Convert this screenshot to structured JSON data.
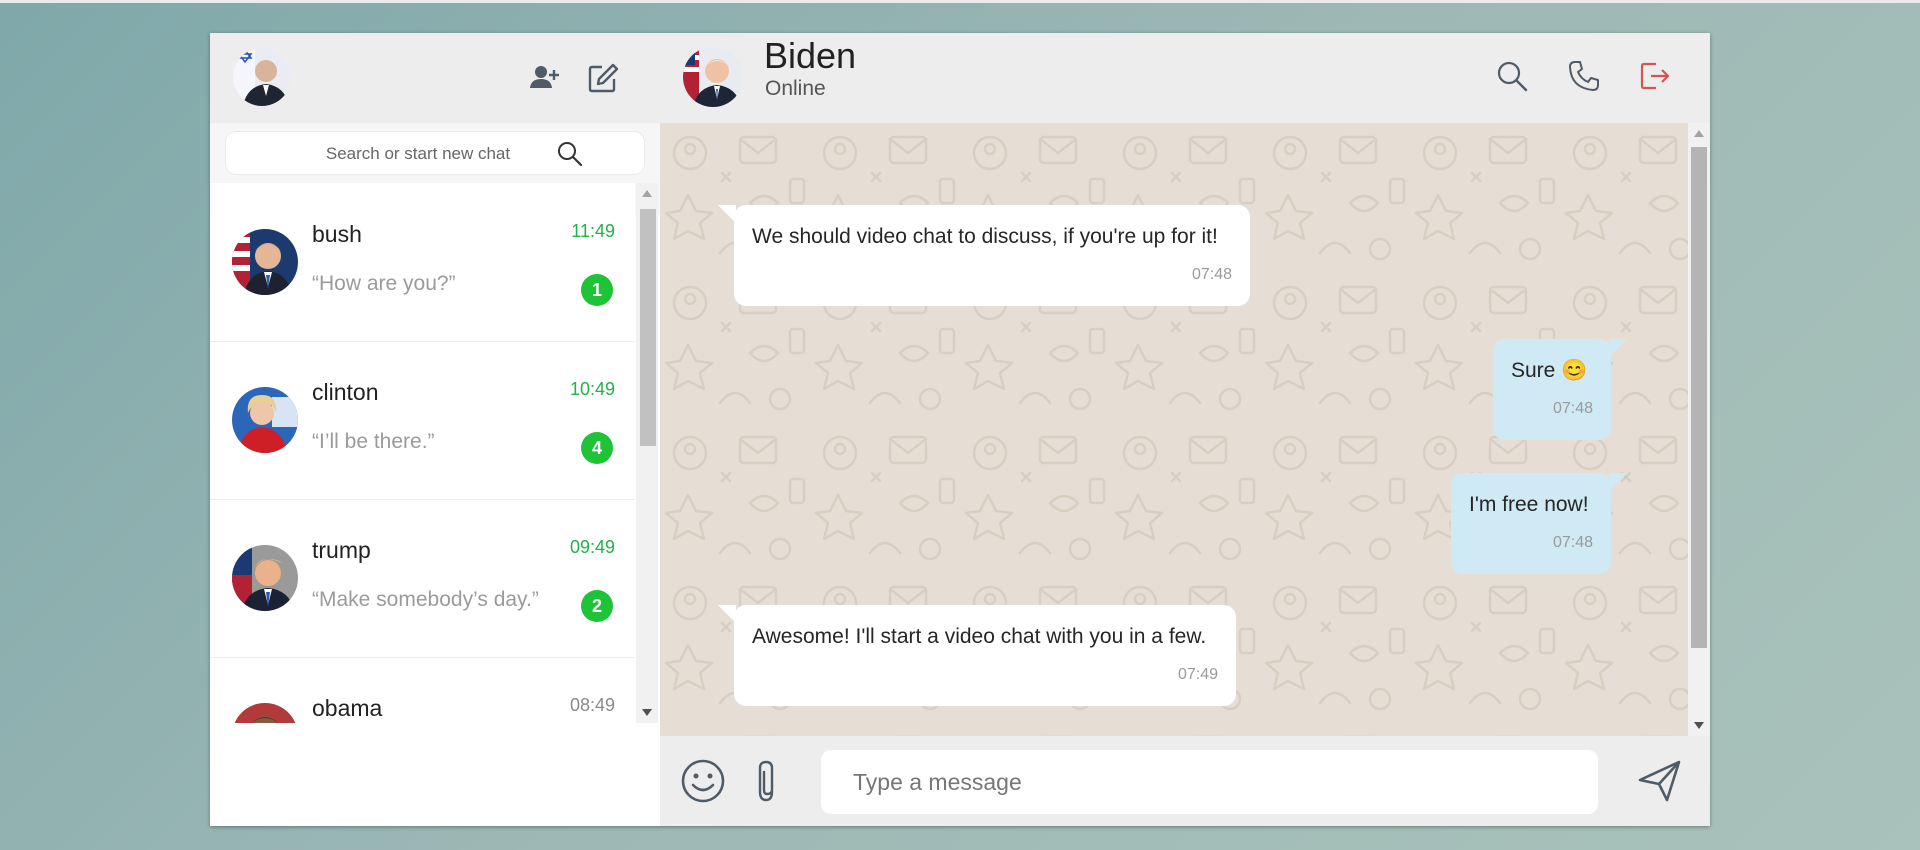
{
  "sidebar": {
    "search_placeholder": "Search or start new chat",
    "chats": [
      {
        "name": "bush",
        "time": "11:49",
        "preview": "“How are you?”",
        "unread": "1",
        "time_color": "#22b14c"
      },
      {
        "name": "clinton",
        "time": "10:49",
        "preview": "“I’ll be there.”",
        "unread": "4",
        "time_color": "#22b14c"
      },
      {
        "name": "trump",
        "time": "09:49",
        "preview": "“Make somebody’s day.”",
        "unread": "2",
        "time_color": "#22b14c"
      },
      {
        "name": "obama",
        "time": "08:49",
        "preview": "",
        "unread": "",
        "time_color": "#8a8a8a"
      }
    ]
  },
  "chat": {
    "contact_name": "Biden",
    "contact_status": "Online",
    "messages": [
      {
        "direction": "incoming",
        "text": "We should video chat to discuss, if you're up for it!",
        "time": "07:48"
      },
      {
        "direction": "outgoing",
        "text": "Sure 😊",
        "time": "07:48"
      },
      {
        "direction": "outgoing",
        "text": "I'm free now!",
        "time": "07:48"
      },
      {
        "direction": "incoming",
        "text": "Awesome! I'll start a video chat with you in a few.",
        "time": "07:49"
      }
    ],
    "input_placeholder": "Type a message"
  },
  "icons": {
    "add_contact": "add-user-icon",
    "new_chat": "edit-icon",
    "search": "search-icon",
    "call": "phone-icon",
    "logout": "logout-icon",
    "emoji": "smiley-icon",
    "attach": "paperclip-icon",
    "send": "send-icon"
  },
  "colors": {
    "unread_badge": "#1ec337",
    "outgoing_bubble": "#cfe9f5",
    "incoming_bubble": "#ffffff",
    "chat_background": "#e6ded4",
    "logout_icon": "#d9534f"
  }
}
